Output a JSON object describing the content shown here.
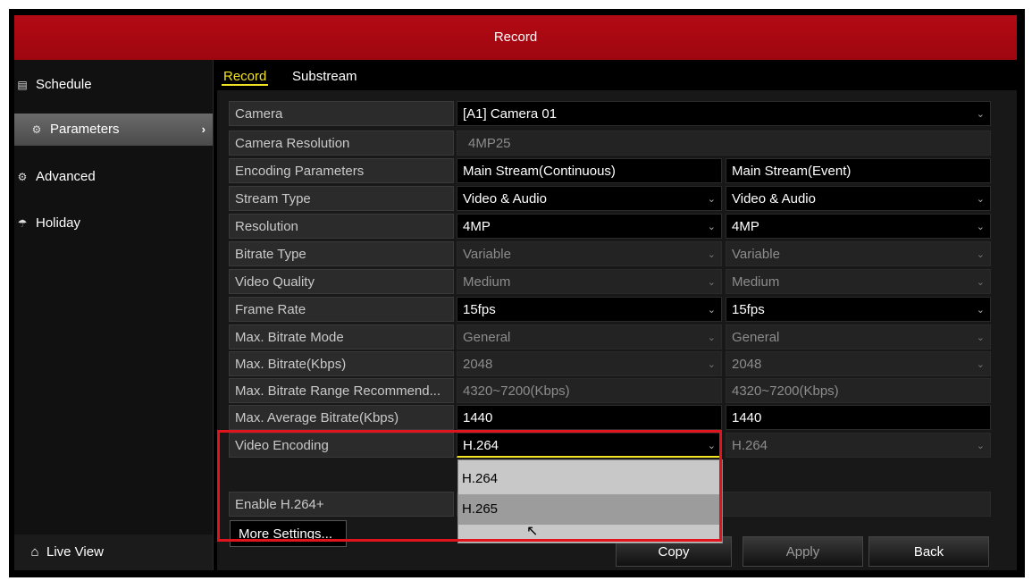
{
  "window": {
    "title": "Record"
  },
  "sidebar": {
    "items": [
      {
        "label": "Schedule",
        "icon": "calendar-icon"
      },
      {
        "label": "Parameters",
        "icon": "gear-icon"
      },
      {
        "label": "Advanced",
        "icon": "gears-icon"
      },
      {
        "label": "Holiday",
        "icon": "umbrella-icon"
      }
    ],
    "live_view": {
      "label": "Live View",
      "icon": "home-icon"
    }
  },
  "tabs": [
    {
      "label": "Record"
    },
    {
      "label": "Substream"
    }
  ],
  "form": {
    "camera": {
      "label": "Camera",
      "value": "[A1] Camera 01"
    },
    "camera_resolution": {
      "label": "Camera Resolution",
      "value": "4MP25"
    },
    "encoding_parameters": {
      "label": "Encoding Parameters",
      "col1": "Main Stream(Continuous)",
      "col2": "Main Stream(Event)"
    },
    "stream_type": {
      "label": "Stream Type",
      "col1": "Video & Audio",
      "col2": "Video & Audio"
    },
    "resolution": {
      "label": "Resolution",
      "col1": "4MP",
      "col2": "4MP"
    },
    "bitrate_type": {
      "label": "Bitrate Type",
      "col1": "Variable",
      "col2": "Variable"
    },
    "video_quality": {
      "label": "Video Quality",
      "col1": "Medium",
      "col2": "Medium"
    },
    "frame_rate": {
      "label": "Frame Rate",
      "col1": "15fps",
      "col2": "15fps"
    },
    "max_bitrate_mode": {
      "label": "Max. Bitrate Mode",
      "col1": "General",
      "col2": "General"
    },
    "max_bitrate": {
      "label": "Max. Bitrate(Kbps)",
      "col1": "2048",
      "col2": "2048"
    },
    "range_recommend": {
      "label": "Max. Bitrate Range Recommend...",
      "col1": "4320~7200(Kbps)",
      "col2": "4320~7200(Kbps)"
    },
    "max_avg_bitrate": {
      "label": "Max. Average Bitrate(Kbps)",
      "col1": "1440",
      "col2": "1440"
    },
    "video_encoding": {
      "label": "Video Encoding",
      "col1": "H.264",
      "col2": "H.264"
    },
    "enable_h264plus": {
      "label": "Enable H.264+"
    }
  },
  "dropdown": {
    "options": [
      "H.264",
      "H.265"
    ]
  },
  "buttons": {
    "more_settings": "More Settings...",
    "copy": "Copy",
    "apply": "Apply",
    "back": "Back"
  }
}
